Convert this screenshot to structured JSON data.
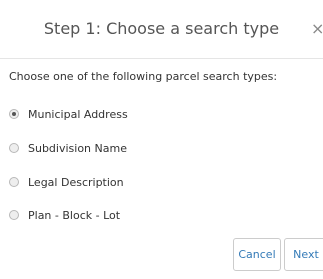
{
  "dialog": {
    "title": "Step 1: Choose a search type",
    "close_glyph": "×",
    "instructions": "Choose one of the following parcel search types:",
    "options": [
      {
        "label": "Municipal Address",
        "checked": true
      },
      {
        "label": "Subdivision Name",
        "checked": false
      },
      {
        "label": "Legal Description",
        "checked": false
      },
      {
        "label": "Plan - Block - Lot",
        "checked": false
      }
    ],
    "buttons": {
      "cancel_label": "Cancel",
      "next_label": "Next"
    },
    "colors": {
      "link_blue": "#337ab7",
      "title_gray": "#555555"
    }
  }
}
